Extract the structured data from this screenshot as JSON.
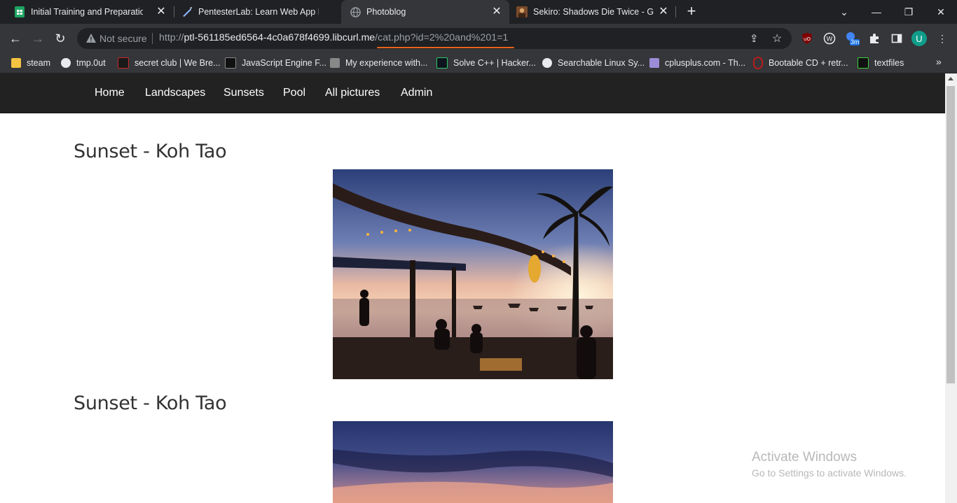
{
  "browser": {
    "tabs": [
      {
        "title": "Initial Training and Preparation -",
        "icon": "sheets-icon"
      },
      {
        "title": "PentesterLab: Learn Web App Pe",
        "icon": "pentesterlab-icon"
      },
      {
        "title": "Photoblog",
        "icon": "globe-icon",
        "active": true
      },
      {
        "title": "Sekiro: Shadows Die Twice - Gar",
        "icon": "sekiro-icon"
      }
    ],
    "security_label": "Not secure",
    "url_scheme": "http://",
    "url_host": "ptl-561185ed6564-4c0a678f4699.libcurl.me",
    "url_path": "/cat.php?id=2%20and%201=1",
    "extension_badge": "3m",
    "profile_initial": "U",
    "bookmarks": [
      {
        "label": "steam"
      },
      {
        "label": "tmp.0ut"
      },
      {
        "label": "secret club | We Bre..."
      },
      {
        "label": "JavaScript Engine F..."
      },
      {
        "label": "My experience with..."
      },
      {
        "label": "Solve C++ | Hacker..."
      },
      {
        "label": "Searchable Linux Sy..."
      },
      {
        "label": "cplusplus.com - Th..."
      },
      {
        "label": "Bootable CD + retr..."
      },
      {
        "label": "textfiles"
      }
    ]
  },
  "site": {
    "nav": [
      "Home",
      "Landscapes",
      "Sunsets",
      "Pool",
      "All pictures",
      "Admin"
    ],
    "posts": [
      {
        "title": "Sunset - Koh Tao"
      },
      {
        "title": "Sunset - Koh Tao"
      }
    ]
  },
  "watermark": {
    "line1": "Activate Windows",
    "line2": "Go to Settings to activate Windows."
  },
  "colors": {
    "url_underline": "#e8631a",
    "site_nav_bg": "#222222"
  }
}
